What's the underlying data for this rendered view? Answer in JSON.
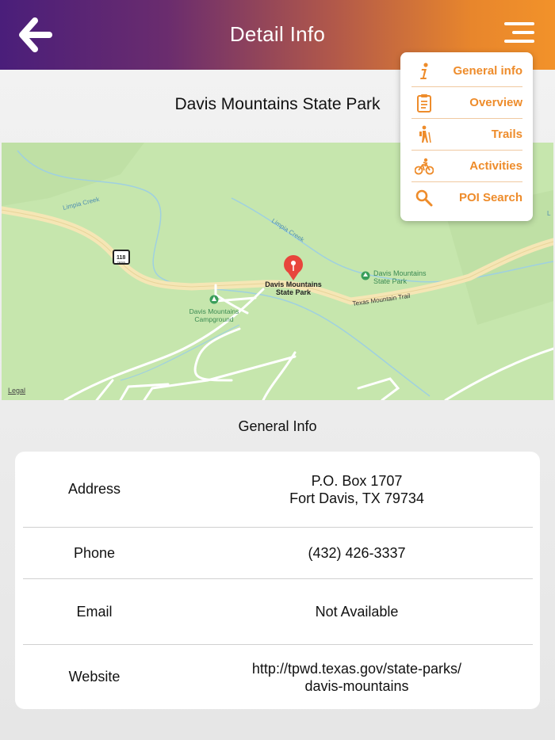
{
  "header": {
    "title": "Detail Info"
  },
  "park": {
    "name": "Davis Mountains State Park"
  },
  "map": {
    "legal": "Legal",
    "labels": {
      "creek1": "Limpia Creek",
      "creek2": "Limpia Creek",
      "route": "118",
      "route_sub": "TEXAS",
      "park_pin_line1": "Davis Mountains",
      "park_pin_line2": "State Park",
      "poi_park_line1": "Davis Mountains",
      "poi_park_line2": "State Park",
      "campground_line1": "Davis Mountains",
      "campground_line2": "Campground",
      "trail": "Texas Mountain Trail",
      "edge": "L"
    }
  },
  "general": {
    "title": "General Info",
    "rows": [
      {
        "label": "Address",
        "value_line1": "P.O. Box 1707",
        "value_line2": "Fort Davis, TX 79734"
      },
      {
        "label": "Phone",
        "value_line1": "(432) 426-3337"
      },
      {
        "label": "Email",
        "value_line1": "Not Available"
      },
      {
        "label": "Website",
        "value_line1": "http://tpwd.texas.gov/state-parks/",
        "value_line2": "davis-mountains"
      }
    ]
  },
  "menu": {
    "items": [
      {
        "label": "General info",
        "icon": "info-icon"
      },
      {
        "label": "Overview",
        "icon": "clipboard-icon"
      },
      {
        "label": "Trails",
        "icon": "hiker-icon"
      },
      {
        "label": "Activities",
        "icon": "bicycle-icon"
      },
      {
        "label": "POI Search",
        "icon": "search-icon"
      }
    ]
  },
  "colors": {
    "accent": "#ee8c2b",
    "header_start": "#4a1e7a",
    "header_end": "#f2922a",
    "map_bg": "#c6e6ad",
    "pin": "#e8453c"
  }
}
